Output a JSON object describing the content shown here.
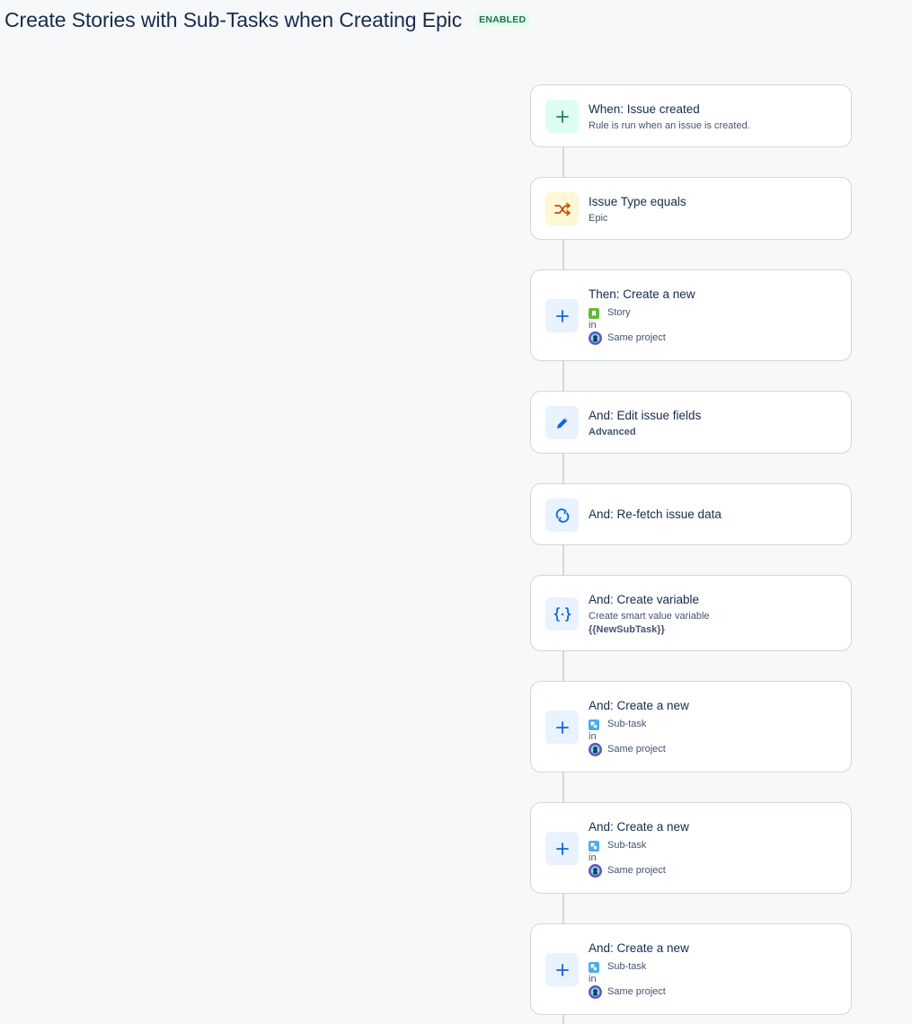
{
  "header": {
    "title": "Create Stories with Sub-Tasks when Creating Epic",
    "status": "ENABLED"
  },
  "flow": {
    "trigger": {
      "title": "When: Issue created",
      "subtitle": "Rule is run when an issue is created."
    },
    "condition": {
      "title": "Issue Type equals",
      "subtitle": "Epic"
    },
    "create_story": {
      "title": "Then: Create a new",
      "issue_type": "Story",
      "in_label": "in",
      "project": "Same project"
    },
    "edit_fields": {
      "title": "And: Edit issue fields",
      "detail": "Advanced"
    },
    "refetch": {
      "title": "And: Re-fetch issue data"
    },
    "variable": {
      "title": "And: Create variable",
      "subtitle": "Create smart value variable",
      "value": "{{NewSubTask}}"
    },
    "subtasks": [
      {
        "title": "And: Create a new",
        "issue_type": "Sub-task",
        "in_label": "in",
        "project": "Same project"
      },
      {
        "title": "And: Create a new",
        "issue_type": "Sub-task",
        "in_label": "in",
        "project": "Same project"
      },
      {
        "title": "And: Create a new",
        "issue_type": "Sub-task",
        "in_label": "in",
        "project": "Same project"
      }
    ]
  },
  "colors": {
    "trigger_icon": "#1f845a",
    "condition_icon": "#c25100",
    "action_icon": "#0c66e4",
    "story_icon": "#63ba3c",
    "subtask_icon": "#4bade8",
    "badge_bg": "#e3fcef",
    "badge_text": "#216e4e"
  },
  "icons": {
    "trigger": "plus-icon",
    "condition": "shuffle-branch-icon",
    "action_create": "plus-icon",
    "action_edit": "pencil-icon",
    "action_refetch": "refresh-icon",
    "action_variable": "curly-braces-icon",
    "story": "bookmark-icon",
    "subtask": "subtask-icon",
    "project": "project-avatar-icon"
  }
}
